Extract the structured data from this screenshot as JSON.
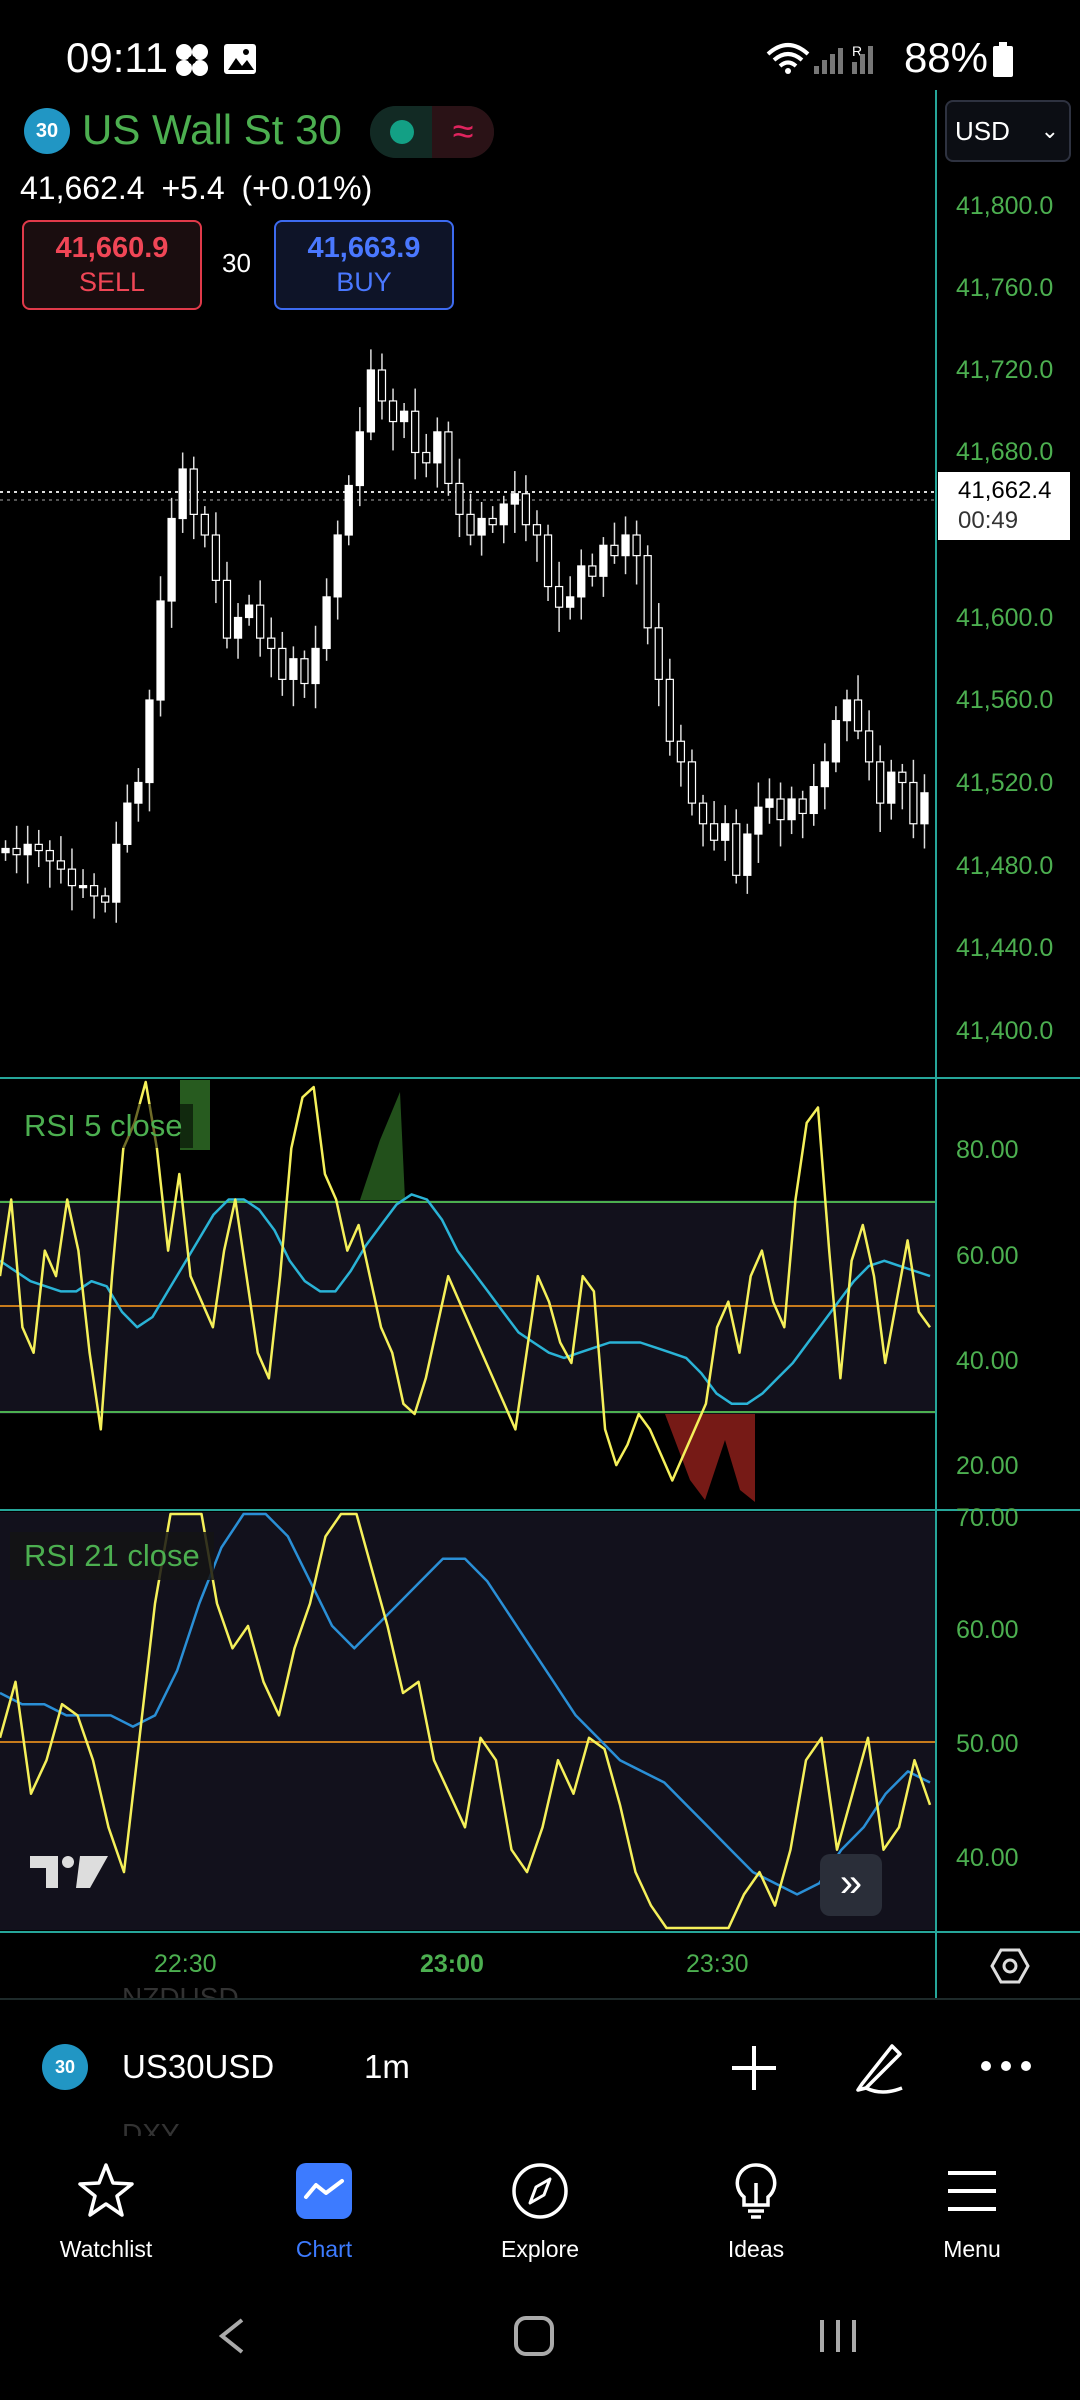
{
  "status_bar": {
    "time": "09:11",
    "battery": "88%",
    "icons": [
      "pinwheel-icon",
      "gallery-icon",
      "wifi-icon",
      "signal-icon",
      "battery-icon"
    ]
  },
  "header": {
    "badge": "30",
    "symbol_name": "US Wall St 30",
    "price": "41,662.4",
    "change": "+5.4",
    "change_pct": "(+0.01%)",
    "sell_price": "41,660.9",
    "sell_label": "SELL",
    "spread": "30",
    "buy_price": "41,663.9",
    "buy_label": "BUY"
  },
  "currency": {
    "value": "USD"
  },
  "price_axis": {
    "labels": [
      "41,800.0",
      "41,760.0",
      "41,720.0",
      "41,680.0",
      "41,600.0",
      "41,560.0",
      "41,520.0",
      "41,480.0",
      "41,440.0",
      "41,400.0"
    ],
    "last_price": "41,662.4",
    "countdown": "00:49"
  },
  "rsi5": {
    "title": "RSI 5 close",
    "axis": [
      "80.00",
      "60.00",
      "40.00",
      "20.00"
    ]
  },
  "rsi21": {
    "title": "RSI 21 close",
    "axis": [
      "70.00",
      "60.00",
      "50.00",
      "40.00"
    ]
  },
  "time_axis": {
    "labels": [
      "22:30",
      "23:00",
      "23:30"
    ]
  },
  "toolbar": {
    "badge": "30",
    "symbol": "US30USD",
    "interval": "1m",
    "ghost_top": "NZDUSD",
    "ghost_bottom": "DXY"
  },
  "bottom_nav": {
    "items": [
      {
        "label": "Watchlist",
        "icon": "star-icon"
      },
      {
        "label": "Chart",
        "icon": "chart-icon"
      },
      {
        "label": "Explore",
        "icon": "compass-icon"
      },
      {
        "label": "Ideas",
        "icon": "lightbulb-icon"
      },
      {
        "label": "Menu",
        "icon": "hamburger-icon"
      }
    ]
  },
  "colors": {
    "up": "#4caf50",
    "rsi_line": "#f5f05a",
    "rsi_ma": "#2ab3d6",
    "sell": "#f04656",
    "buy": "#4a78ff",
    "active_nav": "#3d7bff"
  },
  "chart_data": [
    {
      "type": "candlestick",
      "title": "",
      "ylim": [
        41400,
        41800
      ],
      "ticks_y": [
        41400,
        41440,
        41480,
        41520,
        41560,
        41600,
        41680,
        41720,
        41760,
        41800
      ],
      "ticks_x": [
        "22:30",
        "23:00",
        "23:30"
      ],
      "last_price": 41662.4,
      "close_path": [
        41488,
        41485,
        41490,
        41487,
        41482,
        41478,
        41470,
        41470,
        41465,
        41462,
        41490,
        41510,
        41520,
        41560,
        41608,
        41648,
        41672,
        41650,
        41640,
        41618,
        41590,
        41600,
        41606,
        41590,
        41585,
        41570,
        41580,
        41568,
        41585,
        41610,
        41640,
        41664,
        41690,
        41720,
        41705,
        41695,
        41700,
        41680,
        41675,
        41690,
        41665,
        41650,
        41640,
        41648,
        41645,
        41655,
        41660,
        41645,
        41640,
        41615,
        41605,
        41610,
        41625,
        41620,
        41635,
        41630,
        41640,
        41630,
        41595,
        41570,
        41540,
        41530,
        41510,
        41500,
        41492,
        41500,
        41475,
        41495,
        41508,
        41512,
        41502,
        41512,
        41505,
        41518,
        41530,
        41550,
        41560,
        41545,
        41530,
        41510,
        41525,
        41520,
        41500,
        41515
      ]
    },
    {
      "type": "line",
      "title": "RSI 5 close",
      "ylim": [
        10,
        93
      ],
      "ticks_y": [
        20,
        40,
        60,
        80
      ],
      "bands": [
        30,
        50,
        70
      ],
      "series": [
        {
          "values": [
            55,
            70,
            45,
            40,
            60,
            55,
            70,
            60,
            40,
            25,
            55,
            80,
            85,
            95,
            80,
            60,
            75,
            55,
            50,
            45,
            60,
            70,
            55,
            40,
            35,
            55,
            80,
            90,
            92,
            75,
            70,
            60,
            65,
            55,
            45,
            40,
            30,
            28,
            35,
            45,
            55,
            50,
            45,
            40,
            35,
            30,
            25,
            40,
            55,
            50,
            42,
            38,
            55,
            52,
            25,
            18,
            22,
            28,
            25,
            20,
            15,
            20,
            25,
            30,
            45,
            50,
            40,
            55,
            60,
            50,
            45,
            70,
            85,
            88,
            60,
            35,
            58,
            65,
            55,
            38,
            50,
            62,
            48,
            45
          ]
        },
        {
          "values": [
            58,
            56,
            54,
            53,
            52,
            52,
            54,
            53,
            48,
            45,
            47,
            52,
            57,
            62,
            67,
            70,
            70,
            68,
            64,
            58,
            54,
            52,
            52,
            56,
            61,
            65,
            69,
            71,
            70,
            66,
            60,
            56,
            52,
            48,
            44,
            42,
            40,
            39,
            40,
            41,
            42,
            42,
            42,
            41,
            40,
            39,
            36,
            32,
            30,
            30,
            32,
            35,
            38,
            42,
            46,
            50,
            54,
            57,
            58,
            57,
            56,
            55
          ]
        }
      ]
    },
    {
      "type": "line",
      "title": "RSI 21 close",
      "ylim": [
        33,
        70
      ],
      "ticks_y": [
        40,
        50,
        60,
        70
      ],
      "bands": [
        50
      ],
      "series": [
        {
          "values": [
            50,
            55,
            45,
            48,
            53,
            52,
            48,
            42,
            38,
            50,
            62,
            72,
            75,
            70,
            62,
            58,
            60,
            55,
            52,
            58,
            62,
            68,
            72,
            70,
            65,
            60,
            54,
            55,
            48,
            45,
            42,
            50,
            48,
            40,
            38,
            42,
            48,
            45,
            50,
            49,
            44,
            38,
            35,
            33,
            30,
            33,
            30,
            28,
            36,
            38,
            35,
            40,
            48,
            50,
            40,
            45,
            50,
            40,
            42,
            48,
            44
          ]
        },
        {
          "values": [
            54,
            53,
            53,
            52,
            52,
            52,
            51,
            52,
            56,
            62,
            67,
            70,
            70,
            68,
            64,
            60,
            58,
            60,
            62,
            64,
            66,
            66,
            64,
            61,
            58,
            55,
            52,
            50,
            48,
            47,
            46,
            44,
            42,
            40,
            38,
            37,
            36,
            37,
            40,
            42,
            45,
            47,
            46
          ]
        }
      ]
    }
  ]
}
